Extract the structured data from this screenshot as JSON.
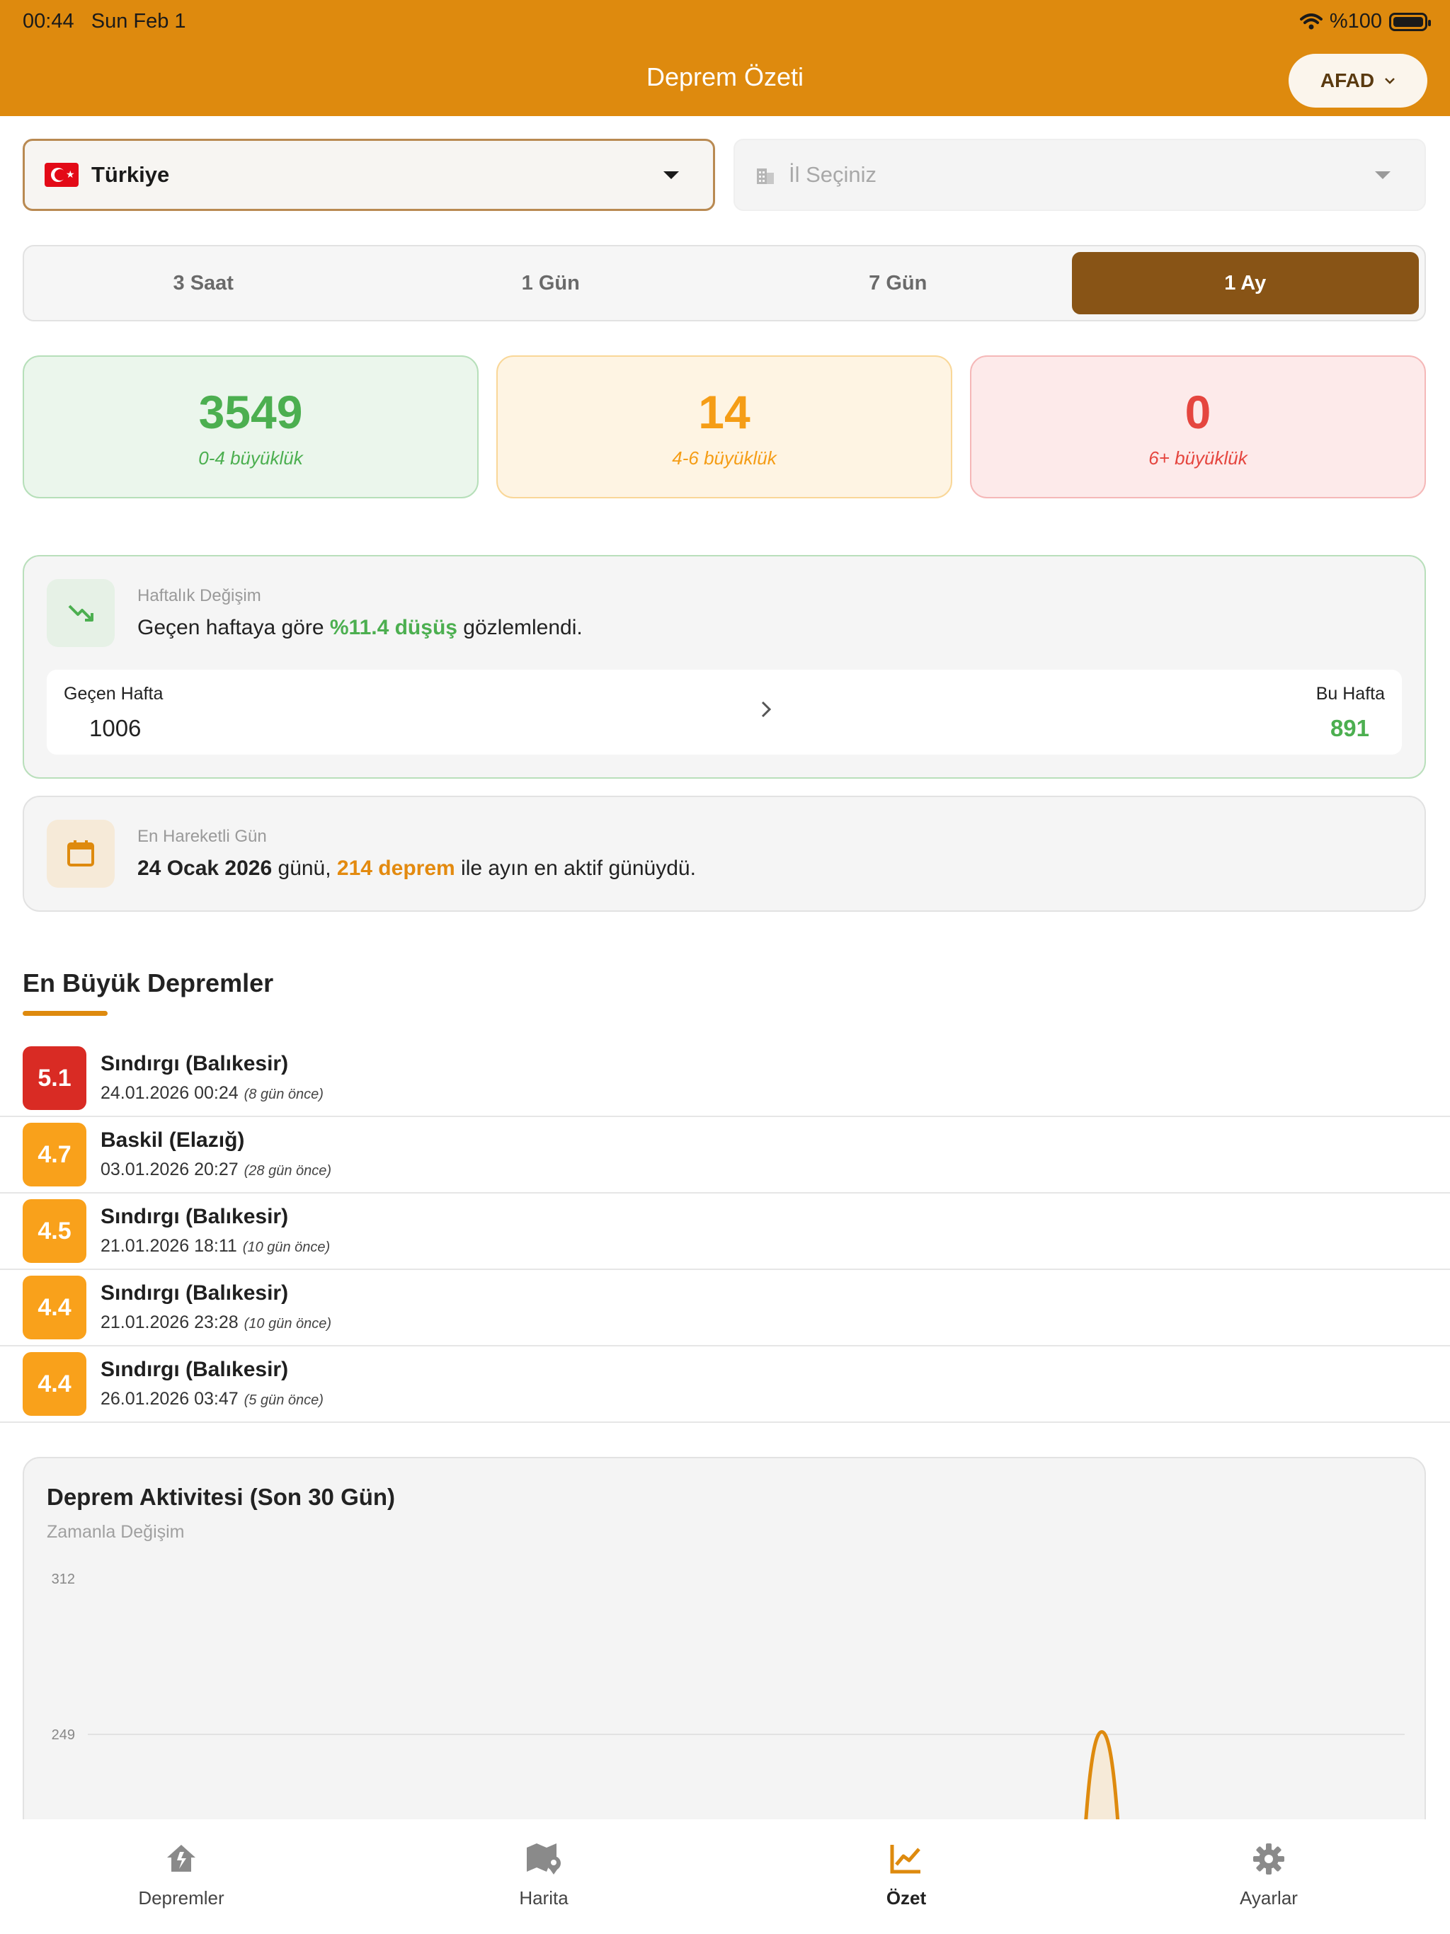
{
  "status": {
    "time": "00:44",
    "date": "Sun Feb 1",
    "battery": "%100"
  },
  "header": {
    "title": "Deprem Özeti",
    "source_label": "AFAD"
  },
  "filters": {
    "country": "Türkiye",
    "city_placeholder": "İl Seçiniz"
  },
  "tabs": [
    {
      "label": "3 Saat"
    },
    {
      "label": "1 Gün"
    },
    {
      "label": "7 Gün"
    },
    {
      "label": "1 Ay",
      "active": true
    }
  ],
  "stats": {
    "low": {
      "value": "3549",
      "label": "0-4 büyüklük"
    },
    "mid": {
      "value": "14",
      "label": "4-6 büyüklük"
    },
    "high": {
      "value": "0",
      "label": "6+ büyüklük"
    }
  },
  "weekly": {
    "subtitle": "Haftalık Değişim",
    "text_before": "Geçen haftaya göre ",
    "highlight": "%11.4 düşüş",
    "text_after": " gözlemlendi.",
    "last_week_label": "Geçen Hafta",
    "last_week_value": "1006",
    "this_week_label": "Bu Hafta",
    "this_week_value": "891"
  },
  "active_day": {
    "subtitle": "En Hareketli Gün",
    "date": "24 Ocak 2026",
    "text_mid": " günü, ",
    "count": "214 deprem",
    "text_after": " ile ayın en aktif günüydü."
  },
  "biggest": {
    "title": "En Büyük Depremler",
    "items": [
      {
        "mag": "5.1",
        "place": "Sındırgı (Balıkesir)",
        "date": "24.01.2026 00:24",
        "ago": "(8 gün önce)",
        "color": "#d92b24"
      },
      {
        "mag": "4.7",
        "place": "Baskil (Elazığ)",
        "date": "03.01.2026 20:27",
        "ago": "(28 gün önce)",
        "color": "#f9a11b"
      },
      {
        "mag": "4.5",
        "place": "Sındırgı (Balıkesir)",
        "date": "21.01.2026 18:11",
        "ago": "(10 gün önce)",
        "color": "#f9a11b"
      },
      {
        "mag": "4.4",
        "place": "Sındırgı (Balıkesir)",
        "date": "21.01.2026 23:28",
        "ago": "(10 gün önce)",
        "color": "#f9a11b"
      },
      {
        "mag": "4.4",
        "place": "Sındırgı (Balıkesir)",
        "date": "26.01.2026 03:47",
        "ago": "(5 gün önce)",
        "color": "#f9a11b"
      }
    ]
  },
  "chart": {
    "title": "Deprem Aktivitesi (Son 30 Gün)",
    "subtitle": "Zamanla Değişim"
  },
  "chart_data": {
    "type": "area",
    "y_ticks": [
      312,
      249
    ],
    "peak": {
      "x_fraction": 0.77,
      "y": 250
    },
    "line_color": "#DE8A0E",
    "fill_color": "#f6ead8"
  },
  "nav": [
    {
      "label": "Depremler",
      "icon": "home-alert-icon"
    },
    {
      "label": "Harita",
      "icon": "map-pin-icon"
    },
    {
      "label": "Özet",
      "icon": "chart-line-icon",
      "active": true
    },
    {
      "label": "Ayarlar",
      "icon": "gear-icon"
    }
  ],
  "colors": {
    "accent": "#DE8A0E",
    "active_tab": "#885416",
    "green": "#4caf50",
    "red": "#e5463f"
  }
}
